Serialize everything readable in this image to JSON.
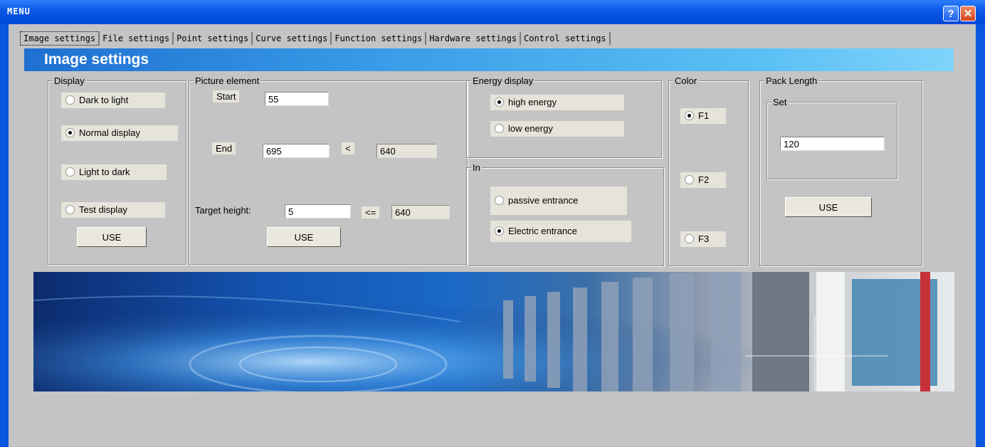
{
  "window": {
    "title": "MENU",
    "help_label": "?",
    "close_label": "✕"
  },
  "tabs": [
    {
      "label": "Image settings"
    },
    {
      "label": "File settings"
    },
    {
      "label": "Point settings"
    },
    {
      "label": "Curve settings"
    },
    {
      "label": "Function settings"
    },
    {
      "label": "Hardware settings"
    },
    {
      "label": "Control settings"
    }
  ],
  "banner": {
    "title": "Image settings"
  },
  "display": {
    "legend": "Display",
    "options": [
      "Dark to light",
      "Normal display",
      "Light to dark",
      "Test display"
    ],
    "selected": "Normal display",
    "use_label": "USE"
  },
  "picture": {
    "legend": "Picture element",
    "start_label": "Start",
    "start_value": "55",
    "end_label": "End",
    "end_value": "695",
    "end_cmp": "<",
    "end_max": "640",
    "height_label": "Target height:",
    "height_value": "5",
    "height_cmp": "<=",
    "height_max": "640",
    "use_label": "USE"
  },
  "energy": {
    "legend": "Energy display",
    "options": [
      "high energy",
      "low energy"
    ],
    "selected": "high energy"
  },
  "entrance": {
    "legend": "In",
    "options": [
      "passive entrance",
      "Electric entrance"
    ],
    "selected": "Electric entrance"
  },
  "color": {
    "legend": "Color",
    "options": [
      "F1",
      "F2",
      "F3"
    ],
    "selected": "F1"
  },
  "pack": {
    "legend": "Pack Length",
    "set_legend": "Set",
    "value": "120",
    "use_label": "USE"
  }
}
